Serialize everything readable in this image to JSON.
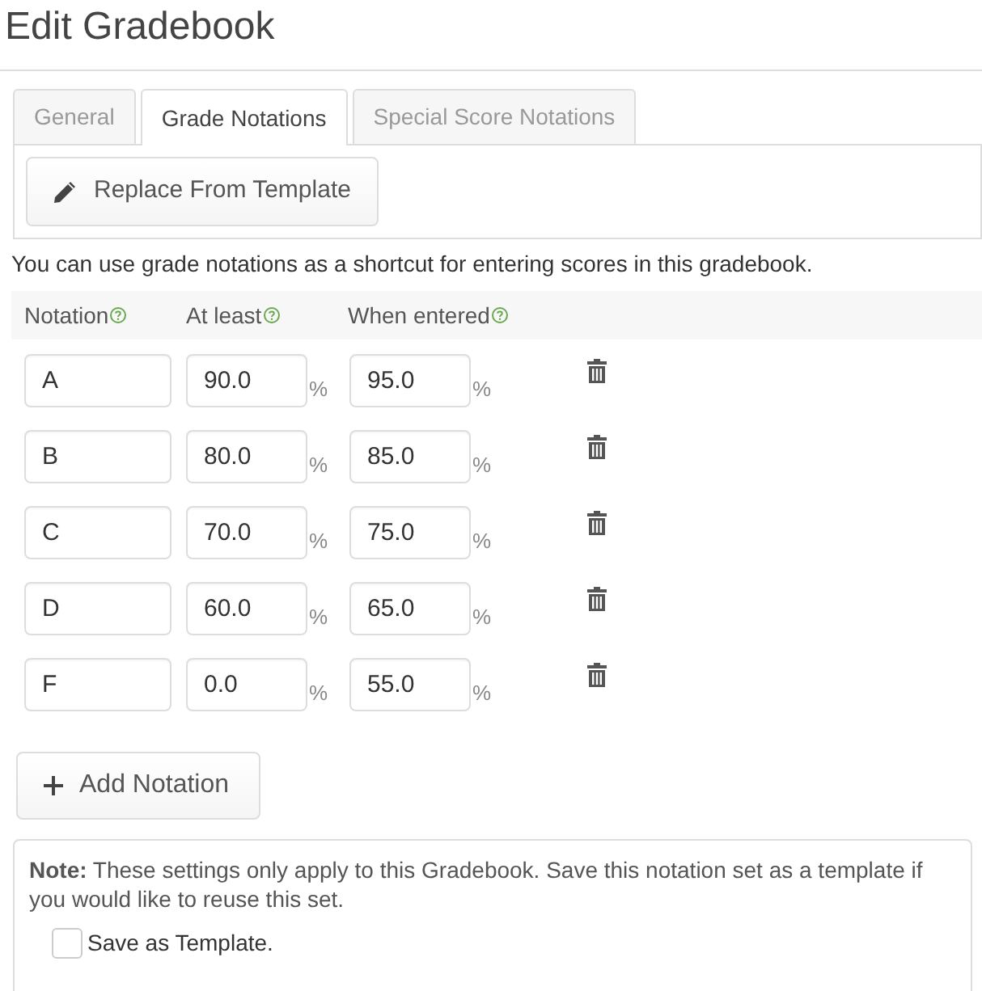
{
  "title": "Edit Gradebook",
  "tabs": [
    {
      "label": "General",
      "selected": false
    },
    {
      "label": "Grade Notations",
      "selected": true
    },
    {
      "label": "Special Score Notations",
      "selected": false
    }
  ],
  "toolbar": {
    "button": "Replace From Template"
  },
  "description": "You can use grade notations as a shortcut for entering scores in this gradebook.",
  "columns": [
    "Notation",
    "At least",
    "When entered"
  ],
  "rows": [
    {
      "notation": "A",
      "at_least": "90.0",
      "at_least_suffix": "%",
      "when_entered": "95.0",
      "when_entered_suffix": "%"
    },
    {
      "notation": "B",
      "at_least": "80.0",
      "at_least_suffix": "%",
      "when_entered": "85.0",
      "when_entered_suffix": "%"
    },
    {
      "notation": "C",
      "at_least": "70.0",
      "at_least_suffix": "%",
      "when_entered": "75.0",
      "when_entered_suffix": "%"
    },
    {
      "notation": "D",
      "at_least": "60.0",
      "at_least_suffix": "%",
      "when_entered": "65.0",
      "when_entered_suffix": "%"
    },
    {
      "notation": "F",
      "at_least": "0.0",
      "at_least_suffix": "%",
      "when_entered": "55.0",
      "when_entered_suffix": "%"
    }
  ],
  "add_button": "Add Notation",
  "note": {
    "text": "**Note:** These settings only apply to this Gradebook. Save this notation set as a template if you would like to reuse this set.",
    "checkbox": {
      "label": "Save as Template.",
      "checked": false
    }
  }
}
